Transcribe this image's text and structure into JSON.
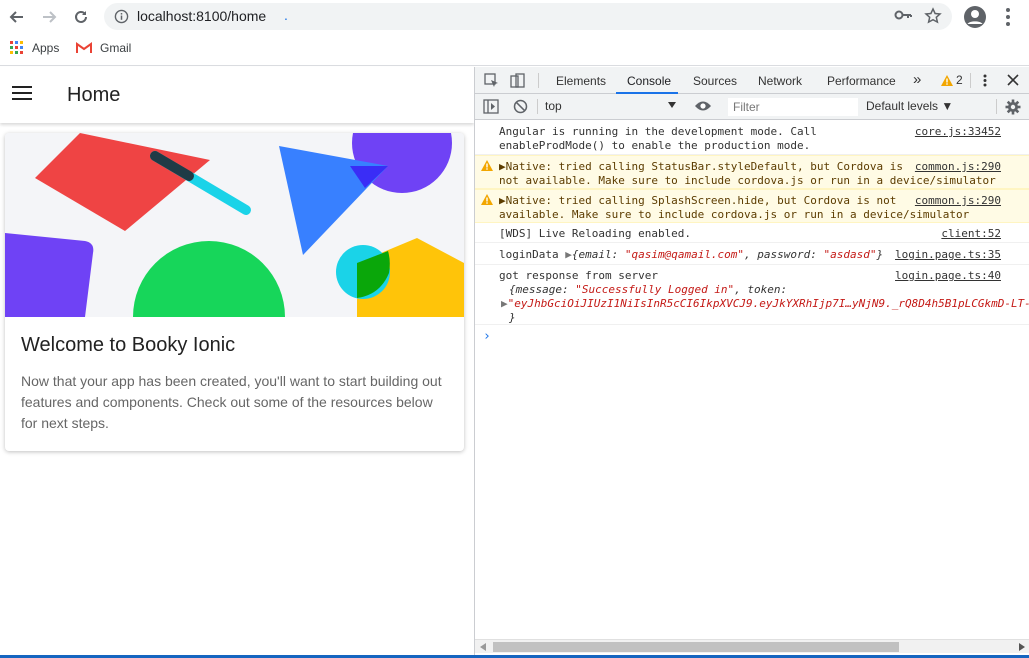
{
  "browser": {
    "url": "localhost:8100/home",
    "url_marker": "."
  },
  "bookmarks": [
    {
      "label": "Apps"
    },
    {
      "label": "Gmail"
    }
  ],
  "app": {
    "title": "Home",
    "card_title": "Welcome to Booky Ionic",
    "card_body": "Now that your app has been created, you'll want to start building out features and components. Check out some of the resources below for next steps."
  },
  "devtools": {
    "tabs": [
      "Elements",
      "Console",
      "Sources",
      "Network",
      "Performance"
    ],
    "more": "»",
    "warning_count": "2",
    "context": "top",
    "filter_placeholder": "Filter",
    "levels": "Default levels ▼"
  },
  "console": {
    "m1_l1": "Angular is running in the development mode. Call",
    "m1_l2": "enableProdMode() to enable the production mode.",
    "m1_src": "core.js:33452",
    "m2_l1": "▶Native: tried calling StatusBar.styleDefault, but Cordova is",
    "m2_l2": "not available. Make sure to include cordova.js or run in a device/simulator",
    "m2_src": "common.js:290",
    "m3_l1": "▶Native: tried calling SplashScreen.hide, but Cordova is not",
    "m3_l2": "available. Make sure to include cordova.js or run in a device/simulator",
    "m3_src": "common.js:290",
    "m4": "[WDS] Live Reloading enabled.",
    "m4_src": "client:52",
    "m5_label": "loginData ",
    "m5_arrow": "▶",
    "m5_open": "{email: ",
    "m5_email": "\"qasim@qamail.com\"",
    "m5_mid": ", password: ",
    "m5_pw": "\"asdasd\"",
    "m5_close": "}",
    "m5_src": "login.page.ts:35",
    "m6_l1": "got response from server",
    "m6_src": "login.page.ts:40",
    "m6_open": "{message: ",
    "m6_msg": "\"Successfully Logged in\"",
    "m6_tok": ", token:",
    "m6_arrow": "▶",
    "m6_token": "\"eyJhbGciOiJIUzI1NiIsInR5cCI6IkpXVCJ9.eyJkYXRhIjp7I…yNjN9._rQ8D4h5B1pLCGkmD-LT-",
    "m6_close": "}",
    "prompt": "›"
  }
}
